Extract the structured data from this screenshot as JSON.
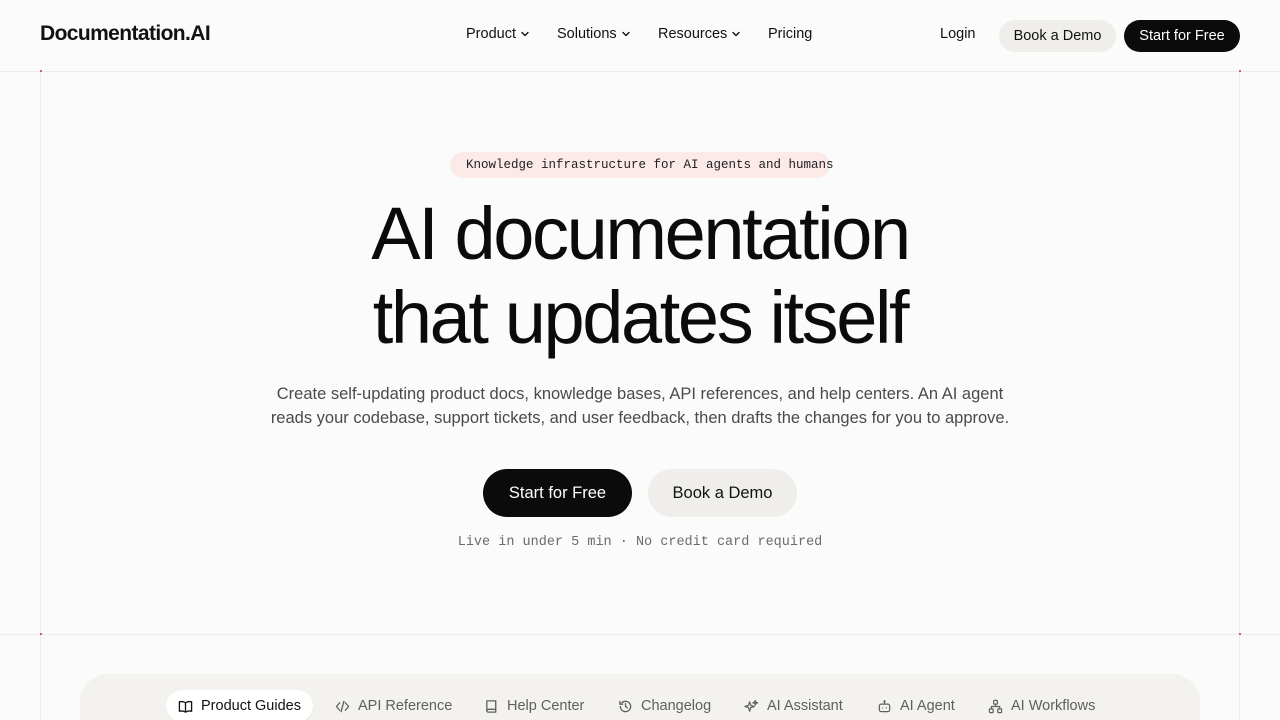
{
  "header": {
    "logo": "Documentation.AI",
    "nav": {
      "product": "Product",
      "solutions": "Solutions",
      "resources": "Resources",
      "pricing": "Pricing"
    },
    "login": "Login",
    "book_demo": "Book a Demo",
    "start_free": "Start for Free"
  },
  "hero": {
    "badge": "Knowledge infrastructure for AI agents and humans",
    "headline_line1": "AI documentation",
    "headline_line2": "that updates itself",
    "subtext_line1": "Create self-updating product docs, knowledge bases, API references, and help centers. An AI agent",
    "subtext_line2": "reads your codebase, support tickets, and user feedback, then drafts the changes for you to approve.",
    "start_free": "Start for Free",
    "book_demo": "Book a Demo",
    "note": "Live in under 5 min · No credit card required"
  },
  "tabs": [
    {
      "label": "Product Guides",
      "icon": "book-open-icon",
      "active": true
    },
    {
      "label": "API Reference",
      "icon": "code-icon",
      "active": false
    },
    {
      "label": "Help Center",
      "icon": "book-icon",
      "active": false
    },
    {
      "label": "Changelog",
      "icon": "history-icon",
      "active": false
    },
    {
      "label": "AI Assistant",
      "icon": "sparkles-icon",
      "active": false
    },
    {
      "label": "AI Agent",
      "icon": "bot-icon",
      "active": false
    },
    {
      "label": "AI Workflows",
      "icon": "workflow-icon",
      "active": false
    }
  ],
  "colors": {
    "background": "#fbfbfb",
    "primary": "#0b0b0b",
    "secondary_button": "#efeeeb",
    "badge_bg": "#fbeae8",
    "badge_dot": "#e35d5d"
  }
}
